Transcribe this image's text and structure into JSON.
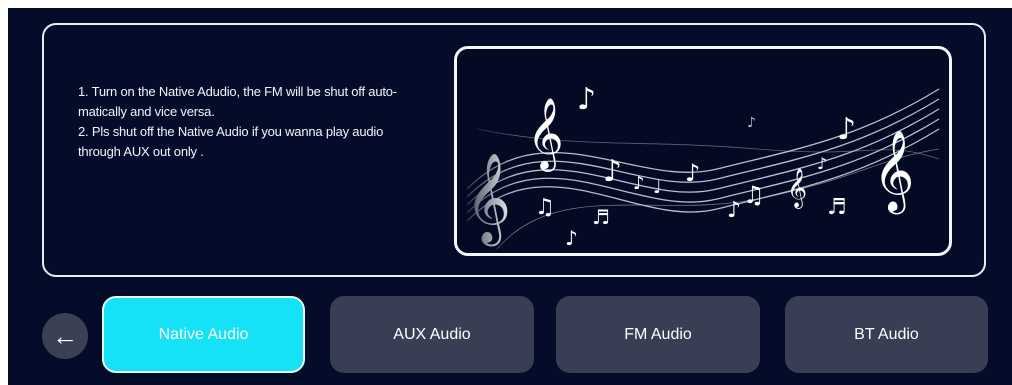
{
  "instructions": {
    "line1": "1. Turn on the Native Adudio, the FM will be shut off auto-",
    "line2": "matically and vice versa.",
    "line3": "2. Pls shut off the Native Audio if you wanna play audio",
    "line4": "through AUX out only ."
  },
  "illustration": {
    "icon": "music-staff-notes-illustration"
  },
  "back_button": {
    "icon": "arrow-left-icon",
    "glyph": "←"
  },
  "tabs": [
    {
      "label": "Native Audio",
      "active": true
    },
    {
      "label": "AUX Audio",
      "active": false
    },
    {
      "label": "FM Audio",
      "active": false
    },
    {
      "label": "BT Audio",
      "active": false
    }
  ],
  "colors": {
    "background": "#040c2a",
    "active_tab": "#15e1f7",
    "inactive_tab": "#393e55",
    "panel_border": "#e8ecf5"
  }
}
